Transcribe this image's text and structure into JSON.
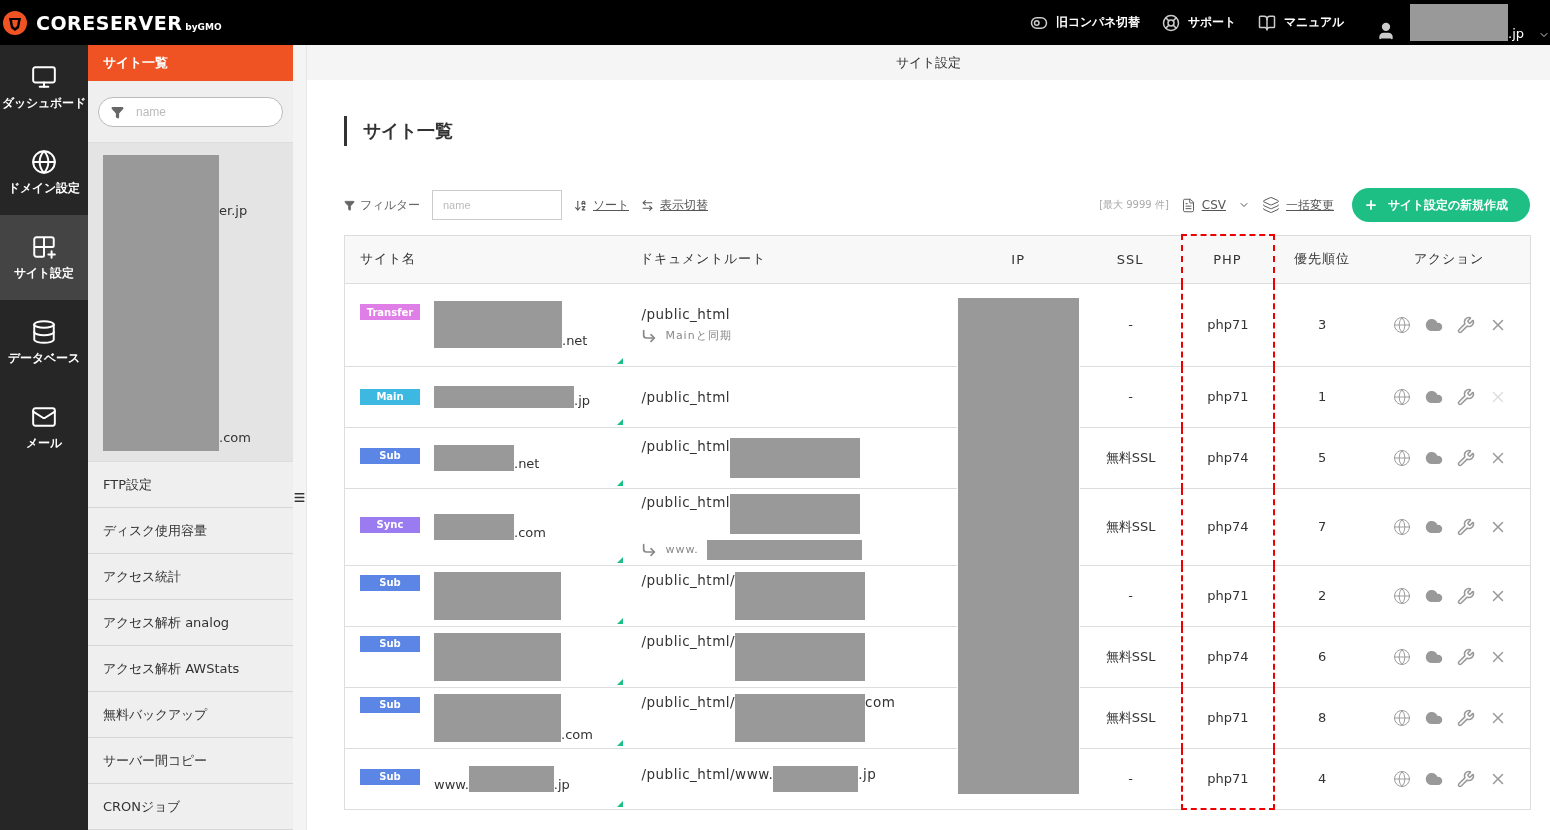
{
  "topbar": {
    "logo": "CORESERVER",
    "logo_sub": "byGMO",
    "links": [
      {
        "kind": "toggle",
        "label": "旧コンパネ切替"
      },
      {
        "kind": "support",
        "label": "サポート"
      },
      {
        "kind": "manual",
        "label": "マニュアル"
      }
    ],
    "user_suffix": ".jp"
  },
  "nav": {
    "items": [
      {
        "kind": "monitor",
        "label": "ダッシュボード",
        "selected": false
      },
      {
        "kind": "www",
        "label": "ドメイン設定",
        "selected": false
      },
      {
        "kind": "grid",
        "label": "サイト設定",
        "selected": true
      },
      {
        "kind": "database",
        "label": "データベース",
        "selected": false
      },
      {
        "kind": "mail",
        "label": "メール",
        "selected": false
      }
    ]
  },
  "subnav": {
    "header": "サイト一覧",
    "search_placeholder": "name",
    "sites": [
      "er.jp",
      ".com"
    ],
    "menu": [
      "FTP設定",
      "ディスク使用容量",
      "アクセス統計",
      "アクセス解析 analog",
      "アクセス解析 AWStats",
      "無料バックアップ",
      "サーバー間コピー",
      "CRONジョブ"
    ]
  },
  "main": {
    "header": "サイト設定",
    "title": "サイト一覧",
    "toolbar": {
      "filter_label": "フィルター",
      "filter_placeholder": "name",
      "sort": "ソート",
      "view_toggle": "表示切替",
      "limit": "[最大 9999 件]",
      "csv": "CSV",
      "bulk": "一括変更",
      "new_button": "サイト設定の新規作成"
    },
    "table": {
      "columns": [
        {
          "label": "サイト名",
          "highlighted": false
        },
        {
          "label": "ドキュメントルート",
          "highlighted": false
        },
        {
          "label": "IP",
          "highlighted": false
        },
        {
          "label": "SSL",
          "highlighted": false
        },
        {
          "label": "PHP",
          "highlighted": true
        },
        {
          "label": "優先順位",
          "highlighted": false
        },
        {
          "label": "アクション",
          "highlighted": false
        }
      ],
      "rows": [
        {
          "badge": "Transfer",
          "color": "#e07ee8",
          "name_suffix": ".net",
          "doc_prefix": "/public_html",
          "doc_redacted": false,
          "sync": {
            "text": "Mainと同期",
            "redacted": false
          },
          "ssl": "-",
          "php": "php71",
          "priority": "3",
          "delete_disabled": false
        },
        {
          "badge": "Main",
          "color": "#3db8e0",
          "name_suffix": ".jp",
          "doc_prefix": "/public_html",
          "doc_redacted": false,
          "ssl": "-",
          "php": "php71",
          "priority": "1",
          "delete_disabled": true
        },
        {
          "badge": "Sub",
          "color": "#5b86e5",
          "name_suffix": ".net",
          "doc_prefix": "/public_html",
          "doc_redacted": true,
          "ssl": "無料SSL",
          "php": "php74",
          "priority": "5",
          "delete_disabled": false
        },
        {
          "badge": "Sync",
          "color": "#9b7bf0",
          "name_suffix": ".com",
          "doc_prefix": "/public_html",
          "doc_redacted": true,
          "sync": {
            "text": "www.",
            "redacted": true
          },
          "ssl": "無料SSL",
          "php": "php74",
          "priority": "7",
          "delete_disabled": false
        },
        {
          "badge": "Sub",
          "color": "#5b86e5",
          "doc_prefix": "/public_html/",
          "doc_redacted": true,
          "ssl": "-",
          "php": "php71",
          "priority": "2",
          "delete_disabled": false
        },
        {
          "badge": "Sub",
          "color": "#5b86e5",
          "doc_prefix": "/public_html/",
          "doc_redacted": true,
          "ssl": "無料SSL",
          "php": "php74",
          "priority": "6",
          "delete_disabled": false
        },
        {
          "badge": "Sub",
          "color": "#5b86e5",
          "name_suffix": ".com",
          "doc_prefix": "/public_html/",
          "doc_redacted": true,
          "doc_suffix": "com",
          "ssl": "無料SSL",
          "php": "php71",
          "priority": "8",
          "delete_disabled": false
        },
        {
          "badge": "Sub",
          "color": "#5b86e5",
          "name_prefix": "www.",
          "name_suffix": ".jp",
          "doc_prefix": "/public_html/www.",
          "doc_redacted": true,
          "doc_suffix": ".jp",
          "ssl": "-",
          "php": "php71",
          "priority": "4",
          "delete_disabled": false
        }
      ]
    }
  }
}
